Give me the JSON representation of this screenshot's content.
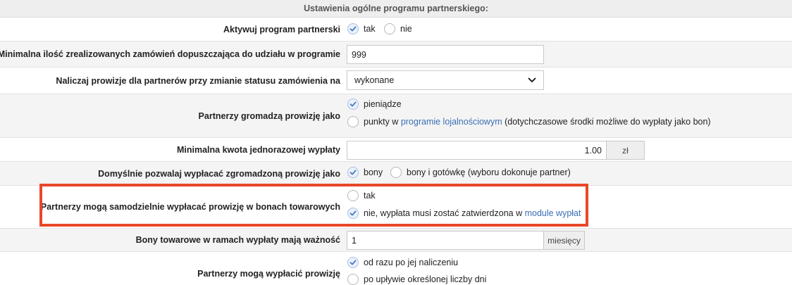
{
  "header": {
    "title": "Ustawienia ogólne programu partnerskiego:"
  },
  "rows": {
    "activate": {
      "label": "Aktywuj program partnerski",
      "opt_yes": "tak",
      "opt_no": "nie"
    },
    "min_orders": {
      "label": "Minimalna ilość zrealizowanych zamówień dopuszczająca do udziału w programie",
      "value": "999"
    },
    "commission_status": {
      "label": "Naliczaj prowizje dla partnerów przy zmianie statusu zamówienia na",
      "selected": "wykonane"
    },
    "accumulate": {
      "label": "Partnerzy gromadzą prowizję jako",
      "opt_money": "pieniądze",
      "opt_points_pre": "punkty w ",
      "opt_points_link": "programie lojalnościowym",
      "opt_points_post": " (dotychczasowe środki możliwe do wypłaty jako bon)"
    },
    "min_payout": {
      "label": "Minimalna kwota jednorazowej wypłaty",
      "value": "1.00",
      "unit": "zł"
    },
    "default_payout": {
      "label": "Domyślnie pozwalaj wypłacać zgromadzoną prowizję jako",
      "opt_vouchers": "bony",
      "opt_both": "bony i gotówkę (wyboru dokonuje partner)"
    },
    "self_payout": {
      "label": "Partnerzy mogą samodzielnie wypłacać prowizję w bonach towarowych",
      "opt_yes": "tak",
      "opt_no_pre": "nie, wypłata musi zostać zatwierdzona w ",
      "opt_no_link": "module wypłat"
    },
    "voucher_validity": {
      "label": "Bony towarowe w ramach wypłaty mają ważność",
      "value": "1",
      "unit": "miesięcy"
    },
    "when_payout": {
      "label": "Partnerzy mogą wypłacić prowizję",
      "opt_immediate": "od razu po jej naliczeniu",
      "opt_after": "po upływie określonej liczby dni"
    }
  },
  "colors": {
    "highlight": "#e8482a",
    "link": "#3a6fb5",
    "check": "#4a7cc0"
  }
}
